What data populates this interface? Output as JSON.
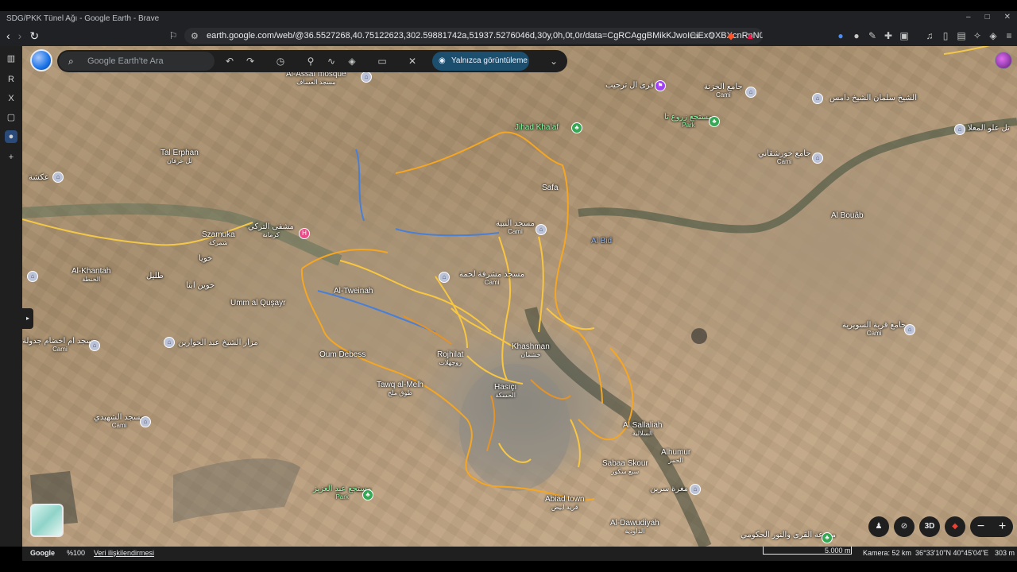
{
  "window": {
    "title": "SDG/PKK Tünel Ağı - Google Earth - Brave",
    "minimize": "–",
    "maximize": "□",
    "close": "✕"
  },
  "browser": {
    "url": "earth.google.com/web/@36.5527268,40.75122623,302.59881742a,51937.5276046d,30y,0h,0t,0r/data=CgRCAggBMikKJwoICiExOXBXcnRnN0o1..."
  },
  "earth": {
    "search_placeholder": "Google Earth'te Ara",
    "view_only_label": "Yalnızca görüntüleme"
  },
  "map_labels": [
    {
      "id": "al-assaf",
      "text": "Al-Assaf mosque",
      "sub": "مسجد العساف",
      "style": "white"
    },
    {
      "id": "tal-erphan",
      "text": "Tal Erphan",
      "sub": "تل عرفان",
      "style": "white"
    },
    {
      "id": "szamuka",
      "text": "Szamuka",
      "sub": "شمركة",
      "style": "white"
    },
    {
      "id": "al-khantah",
      "text": "Al-Khantah",
      "sub": "الخنطة",
      "style": "white"
    },
    {
      "id": "umm-al-qusayr",
      "text": "Umm al Quşayr",
      "sub": "",
      "style": "white"
    },
    {
      "id": "al-tweinah",
      "text": "Al-Tweinah",
      "sub": "",
      "style": "white"
    },
    {
      "id": "oum-debess",
      "text": "Oum Debess",
      "sub": "",
      "style": "white"
    },
    {
      "id": "rojhilat",
      "text": "Rojhilat",
      "sub": "روجهلات",
      "style": "white"
    },
    {
      "id": "tawq-al-melh",
      "text": "Tawq al-Melh",
      "sub": "طوق ملح",
      "style": "white"
    },
    {
      "id": "khashman",
      "text": "Khashman",
      "sub": "خشمان",
      "style": "white"
    },
    {
      "id": "hasici",
      "text": "Hasıçı",
      "sub": "الحسكة",
      "style": "white"
    },
    {
      "id": "safa",
      "text": "Safa",
      "sub": "",
      "style": "white"
    },
    {
      "id": "jihad-khalaf",
      "text": "Jihad Khalaf",
      "sub": "",
      "style": "green"
    },
    {
      "id": "al-bid",
      "text": "Al Bid",
      "sub": "",
      "style": "blue"
    },
    {
      "id": "al-bouab",
      "text": "Al Bouâb",
      "sub": "",
      "style": "white"
    },
    {
      "id": "al-sallaliah",
      "text": "Al Sallaliah",
      "sub": "السلالية",
      "style": "white"
    },
    {
      "id": "alhumur",
      "text": "Alhumur",
      "sub": "الحمر",
      "style": "white"
    },
    {
      "id": "sabaa-skour",
      "text": "Sabaa Skour",
      "sub": "سبع سكور",
      "style": "white"
    },
    {
      "id": "abiad-town",
      "text": "Abiad town",
      "sub": "قرية ابيض",
      "style": "white"
    },
    {
      "id": "al-dawudiyah",
      "text": "Al-Dawudiyah",
      "sub": "الداودية",
      "style": "white"
    },
    {
      "id": "park-top",
      "text": "مستجع زروع تا",
      "sub": "Park",
      "style": "green"
    },
    {
      "id": "park-bottom",
      "text": "مستجع عبد العزيز",
      "sub": "Park",
      "style": "green"
    },
    {
      "id": "cami-1",
      "text": "جامع الخزنة",
      "sub": "Cami",
      "style": "white"
    },
    {
      "id": "cami-2",
      "text": "الشيخ سلمان الشيخ دامس",
      "sub": "",
      "style": "white"
    },
    {
      "id": "cami-3",
      "text": "جامع خورشقاني",
      "sub": "Cami",
      "style": "white"
    },
    {
      "id": "cami-4",
      "text": "مسجد النبية",
      "sub": "Cami",
      "style": "white"
    },
    {
      "id": "cami-5",
      "text": "مسجد مشرفة لحمة",
      "sub": "Cami",
      "style": "white"
    },
    {
      "id": "cami-6",
      "text": "مسجد ام اخضام جدولة",
      "sub": "Cami",
      "style": "white"
    },
    {
      "id": "cami-7",
      "text": "مسجد الشهيدي",
      "sub": "Cami",
      "style": "white"
    },
    {
      "id": "cami-8",
      "text": "جامع قرية السويرية",
      "sub": "Cami",
      "style": "white"
    },
    {
      "id": "sheikh-hospital",
      "text": "مشفى التركي",
      "sub": "كرمانة",
      "style": "white"
    },
    {
      "id": "tarhib",
      "text": "قرى ال ترحيب",
      "sub": "",
      "style": "white"
    },
    {
      "id": "akasha",
      "text": "عكشة",
      "sub": "",
      "style": "white"
    },
    {
      "id": "khawab",
      "text": "خويا",
      "sub": "",
      "style": "white"
    },
    {
      "id": "tilal",
      "text": "طليل",
      "sub": "",
      "style": "white"
    },
    {
      "id": "khawab2",
      "text": "خوين ابنا",
      "sub": "",
      "style": "white"
    },
    {
      "id": "mazar",
      "text": "مزار الشيخ عبد الحوارين",
      "sub": "",
      "style": "white"
    },
    {
      "id": "tal-almaa",
      "text": "تل علو المعلا",
      "sub": "",
      "style": "white"
    },
    {
      "id": "mazaria",
      "text": "مزرعة القرى والنور الحكومي",
      "sub": "Park",
      "style": "white"
    },
    {
      "id": "rgut",
      "text": "مغرة سرين",
      "sub": "",
      "style": "white"
    }
  ],
  "bottom": {
    "brand": "Google",
    "zoom": "%100",
    "attribution": "Veri ilişkilendirmesi",
    "scale": "5.000 m",
    "camera": "Kamera: 52 km",
    "coords": "36°33'10\"N 40°45'04\"E",
    "elevation": "303 m"
  },
  "controls": {
    "mode_3d": "3D",
    "zoom_out": "−",
    "zoom_in": "+"
  },
  "colors": {
    "tunnel_route": "#f5a623",
    "tunnel_network": "#f8c640",
    "river": "#4a7fd6",
    "view_only_bg": "#1c4f6d"
  }
}
